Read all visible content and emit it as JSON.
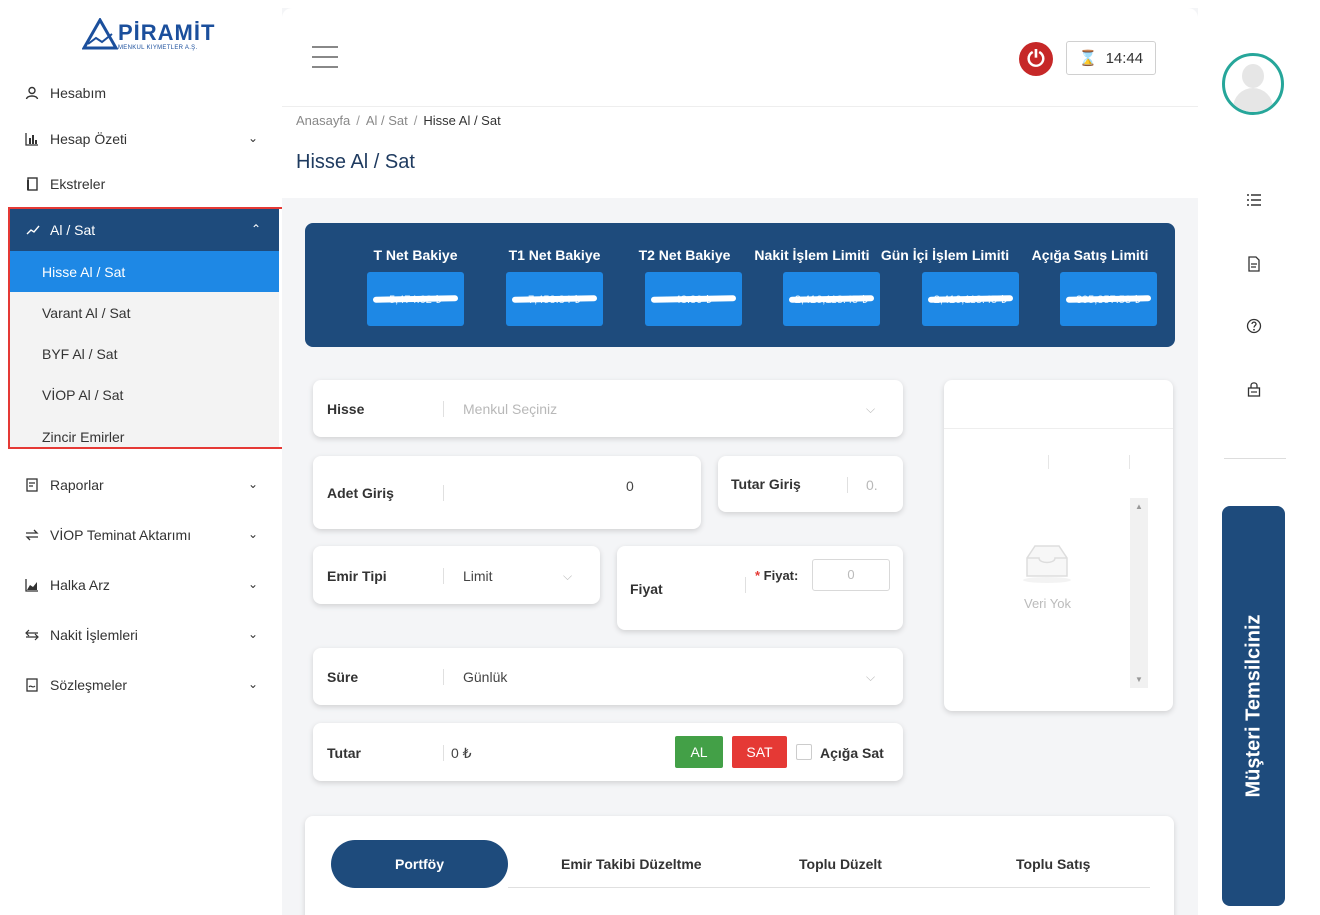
{
  "brand": {
    "name": "PİRAMİT",
    "tagline": "MENKUL KIYMETLER A.Ş."
  },
  "sidebar": {
    "items": [
      {
        "label": "Hesabım",
        "icon": "user-icon"
      },
      {
        "label": "Hesap Özeti",
        "icon": "bar-chart-icon"
      },
      {
        "label": "Ekstreler",
        "icon": "document-icon"
      }
    ],
    "group": {
      "label": "Al / Sat",
      "icon": "trend-icon",
      "subitems": [
        "Hisse Al / Sat",
        "Varant Al / Sat",
        "BYF Al / Sat",
        "VİOP Al / Sat",
        "Zincir Emirler"
      ],
      "active": "Hisse Al / Sat"
    },
    "items_bottom": [
      {
        "label": "Raporlar",
        "icon": "report-icon"
      },
      {
        "label": "VİOP Teminat Aktarımı",
        "icon": "transfer-icon"
      },
      {
        "label": "Halka Arz",
        "icon": "area-chart-icon"
      },
      {
        "label": "Nakit İşlemleri",
        "icon": "exchange-icon"
      },
      {
        "label": "Sözleşmeler",
        "icon": "contract-icon"
      }
    ]
  },
  "topbar": {
    "time": "14:44"
  },
  "breadcrumb": {
    "home": "Anasayfa",
    "mid": "Al / Sat",
    "current": "Hisse Al / Sat"
  },
  "page": {
    "title": "Hisse Al / Sat"
  },
  "balances": [
    {
      "label": "T Net Bakiye",
      "value": "5,474.62 ₺"
    },
    {
      "label": "T1 Net Bakiye",
      "value": "7,453.84 ₺"
    },
    {
      "label": "T2 Net Bakiye",
      "value": "48.80 ₺"
    },
    {
      "label": "Nakit İşlem Limiti",
      "value": "2,416,113.45 ₺"
    },
    {
      "label": "Gün İçi İşlem Limiti",
      "value": "2,416,113.45 ₺"
    },
    {
      "label": "Açığa Satış Limiti",
      "value": "805,357.53 ₺"
    }
  ],
  "form": {
    "hisse_label": "Hisse",
    "hisse_placeholder": "Menkul Seçiniz",
    "adet_label": "Adet Giriş",
    "adet_value": "0",
    "tutar_giris_label": "Tutar Giriş",
    "tutar_giris_value": "0.",
    "emir_tipi_label": "Emir Tipi",
    "emir_tipi_value": "Limit",
    "fiyat_label": "Fiyat",
    "fiyat_field_label": "Fiyat:",
    "fiyat_value": "0",
    "sure_label": "Süre",
    "sure_value": "Günlük",
    "tutar_label": "Tutar",
    "tutar_value": "0 ₺",
    "al_label": "AL",
    "sat_label": "SAT",
    "aciga_sat_label": "Açığa Sat"
  },
  "side_panel": {
    "empty_text": "Veri Yok"
  },
  "tabs": {
    "portfoy": "Portföy",
    "emir_takibi": "Emir Takibi Düzeltme",
    "toplu_duzelt": "Toplu Düzelt",
    "toplu_satis": "Toplu Satış"
  },
  "representative": {
    "label": "Müşteri Temsilciniz"
  },
  "colors": {
    "primary": "#1e4b7c",
    "accent": "#1e88e5",
    "buy": "#43a047",
    "sell": "#e53935"
  }
}
